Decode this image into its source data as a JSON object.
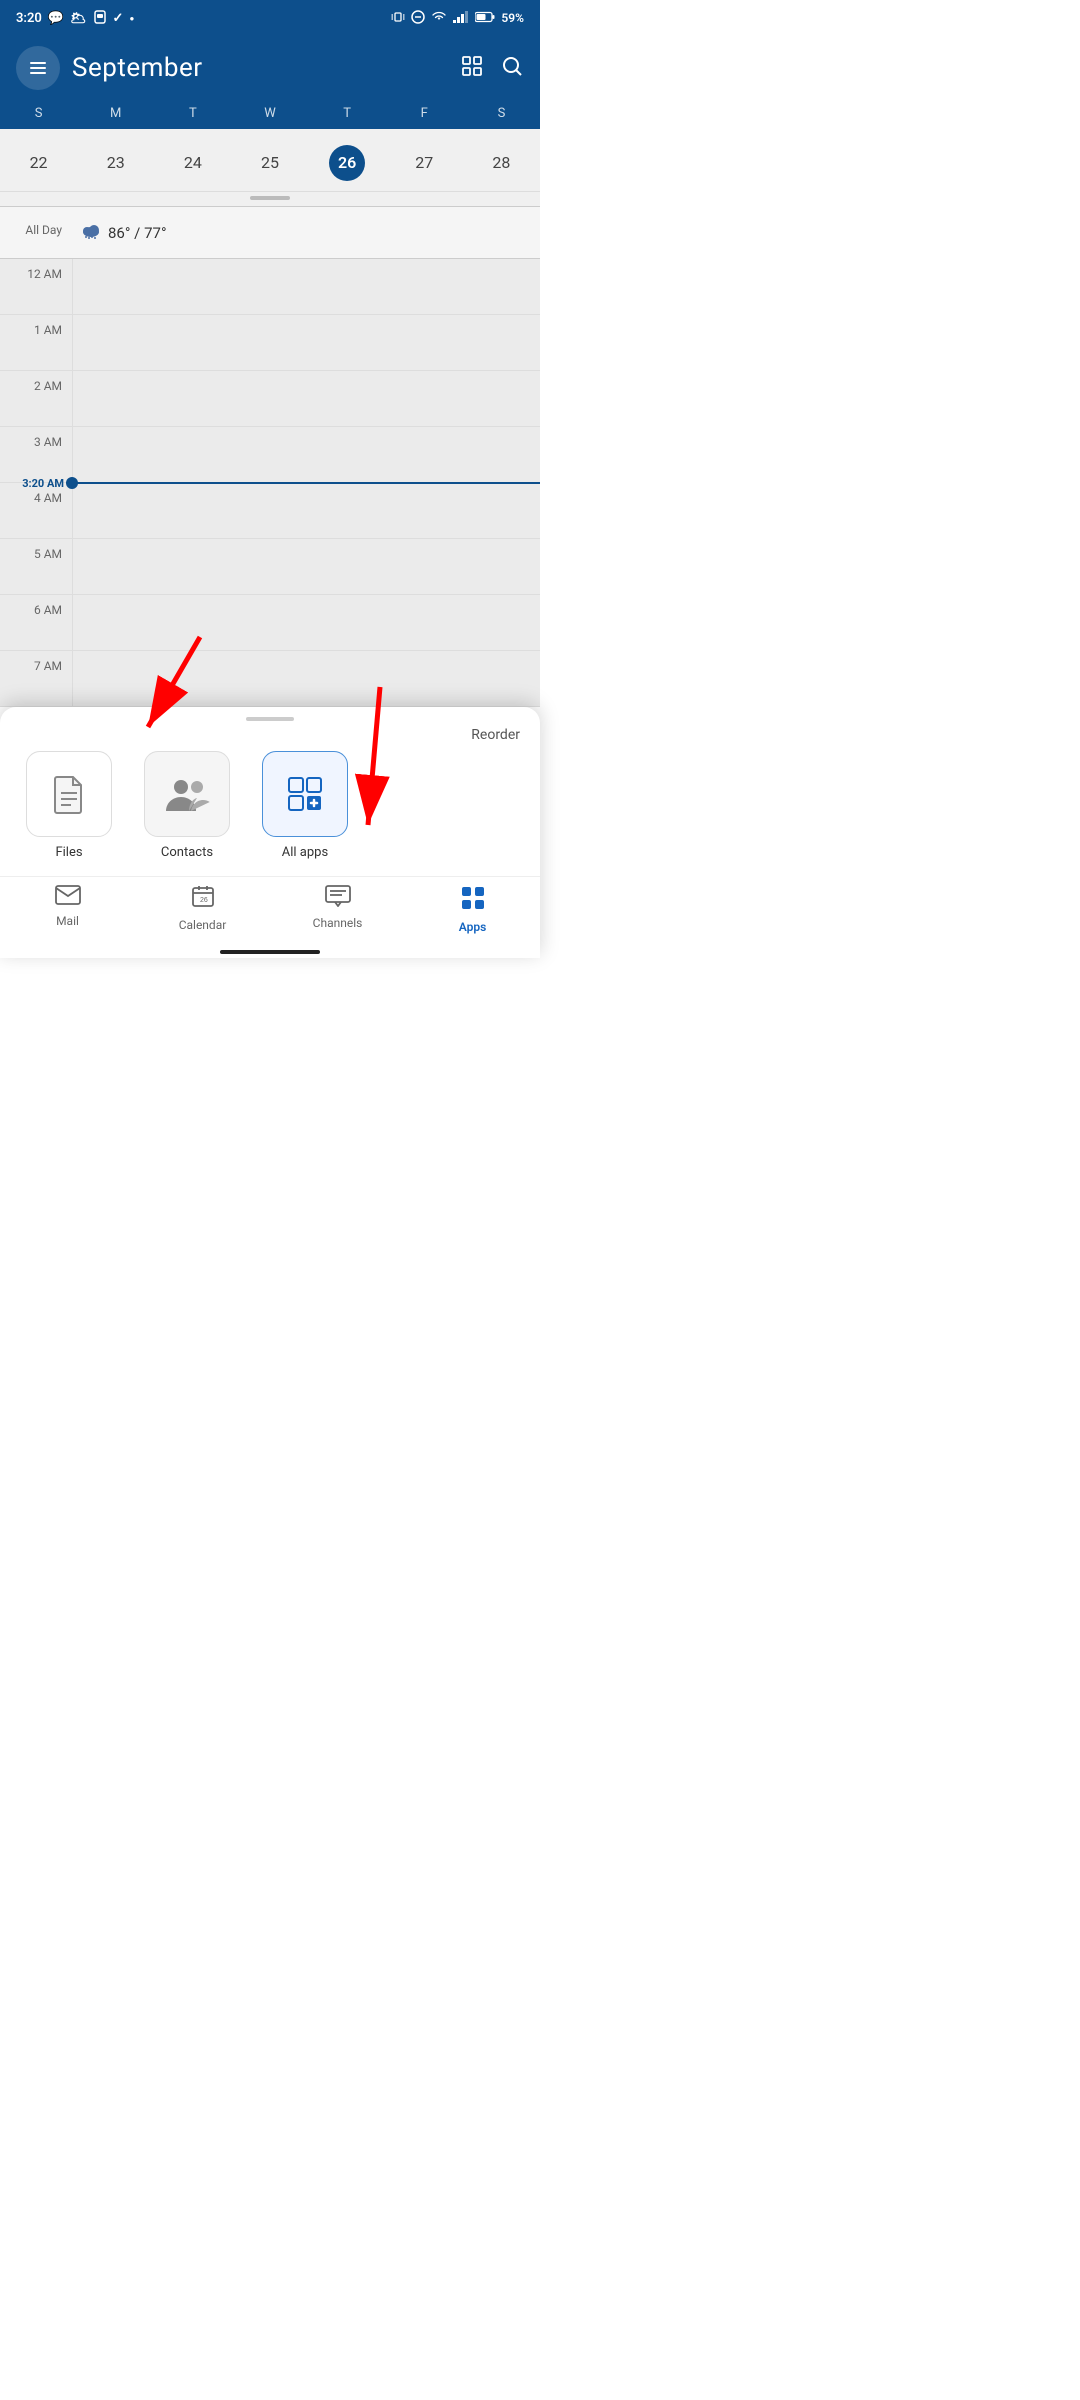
{
  "statusBar": {
    "time": "3:20",
    "battery": "59%",
    "signal": "signal-icon",
    "wifi": "wifi-icon"
  },
  "header": {
    "title": "September",
    "menuIcon": "menu-icon",
    "gridIcon": "grid-view-icon",
    "searchIcon": "search-icon"
  },
  "daysOfWeek": [
    "S",
    "M",
    "T",
    "W",
    "T",
    "F",
    "S"
  ],
  "weekDates": [
    {
      "num": "22",
      "today": false
    },
    {
      "num": "23",
      "today": false
    },
    {
      "num": "24",
      "today": false
    },
    {
      "num": "25",
      "today": false
    },
    {
      "num": "26",
      "today": true
    },
    {
      "num": "27",
      "today": false
    },
    {
      "num": "28",
      "today": false
    }
  ],
  "allDay": {
    "label": "All Day",
    "weather": "86° / 77°"
  },
  "timeSlots": [
    {
      "label": "12 AM"
    },
    {
      "label": "1 AM"
    },
    {
      "label": "2 AM"
    },
    {
      "label": "3 AM"
    },
    {
      "label": ""
    },
    {
      "label": "4 AM"
    },
    {
      "label": "5 AM"
    },
    {
      "label": "6 AM"
    },
    {
      "label": "7 AM"
    }
  ],
  "currentTime": "3:20 AM",
  "bottomSheet": {
    "reorderLabel": "Reorder",
    "dragHandle": true,
    "apps": [
      {
        "id": "files",
        "label": "Files",
        "icon": "file-icon"
      },
      {
        "id": "contacts",
        "label": "Contacts",
        "icon": "contacts-icon"
      },
      {
        "id": "allapps",
        "label": "All apps",
        "icon": "allapps-icon"
      }
    ]
  },
  "bottomNav": {
    "items": [
      {
        "id": "mail",
        "label": "Mail",
        "icon": "mail-icon",
        "active": false
      },
      {
        "id": "calendar",
        "label": "Calendar",
        "icon": "calendar-icon",
        "active": false
      },
      {
        "id": "channels",
        "label": "Channels",
        "icon": "channels-icon",
        "active": false
      },
      {
        "id": "apps",
        "label": "Apps",
        "icon": "apps-icon",
        "active": true
      }
    ]
  }
}
